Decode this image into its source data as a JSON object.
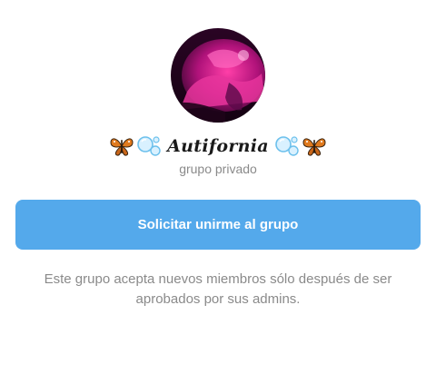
{
  "group": {
    "name": "Autifornia",
    "decor_left": [
      "butterfly-icon",
      "bubbles-icon"
    ],
    "decor_right": [
      "bubbles-icon",
      "butterfly-icon"
    ],
    "type_label": "grupo privado"
  },
  "join_button": {
    "label": "Solicitar unirme al grupo",
    "color": "#54a9eb"
  },
  "info_text": "Este grupo acepta nuevos miembros sólo después de ser aprobados por sus admins.",
  "colors": {
    "accent": "#54a9eb",
    "muted_text": "#8a8a8a",
    "avatar_tint": "#d21f8a"
  }
}
